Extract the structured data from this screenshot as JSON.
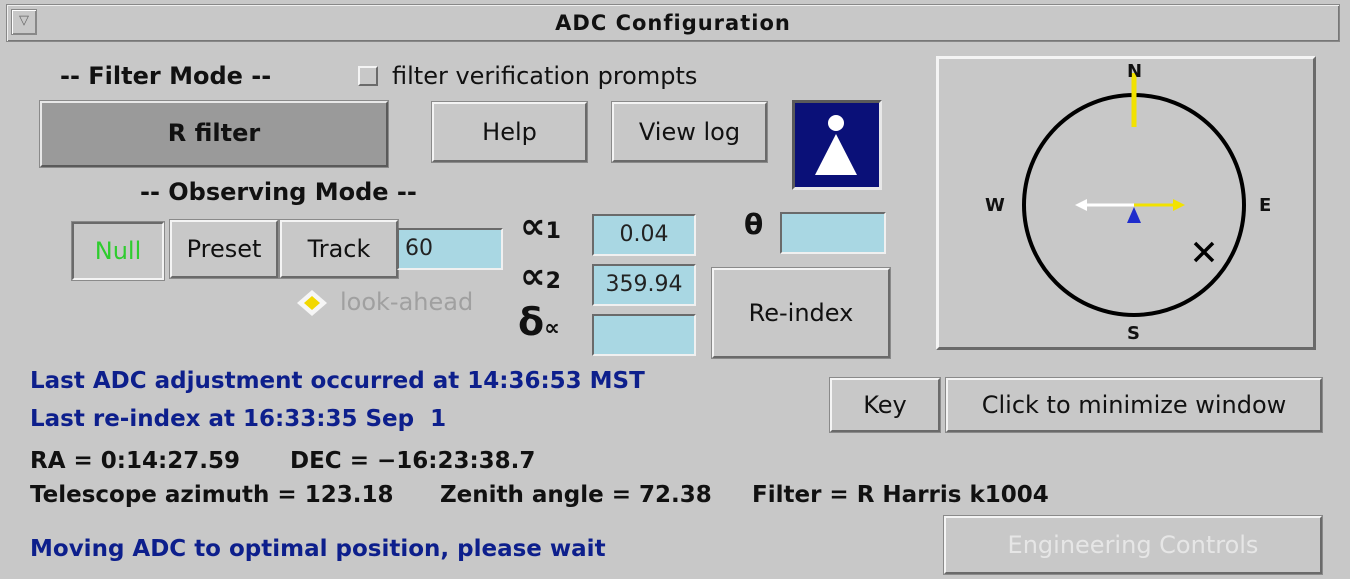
{
  "window": {
    "title": "ADC Configuration",
    "menu_glyph": "▽"
  },
  "filter_mode": {
    "heading": "-- Filter Mode --",
    "verification_label": "filter verification prompts",
    "filter_button": "R filter"
  },
  "toolbar": {
    "help": "Help",
    "view_log": "View log"
  },
  "observing_mode": {
    "heading": "-- Observing Mode --",
    "null_label": "Null",
    "preset_label": "Preset",
    "track_label": "Track",
    "track_value": "60",
    "lookahead_label": "look-ahead"
  },
  "angles": {
    "alpha1_symbol": "∝",
    "alpha1_sub": "1",
    "alpha1_value": "0.04",
    "alpha2_symbol": "∝",
    "alpha2_sub": "2",
    "alpha2_value": "359.94",
    "delta_symbol": "δ",
    "delta_sub": "∝",
    "delta_value": "",
    "theta_symbol": "θ",
    "theta_value": "",
    "reindex_button": "Re-index"
  },
  "compass": {
    "n": "N",
    "s": "S",
    "e": "E",
    "w": "W"
  },
  "buttons": {
    "key": "Key",
    "minimize": "Click to minimize window",
    "engineering": "Engineering Controls"
  },
  "status": {
    "last_adjustment": "Last ADC adjustment occurred at 14:36:53 MST",
    "last_reindex": "Last re-index at 16:33:35 Sep  1",
    "ra": "RA = 0:14:27.59",
    "dec": "DEC = −16:23:38.7",
    "azimuth": "Telescope azimuth = 123.18",
    "zenith": "Zenith angle = 72.38",
    "filter": "Filter = R Harris k1004",
    "message": "Moving ADC to optimal position, please wait"
  },
  "colors": {
    "background": "#c8c8c8",
    "field": "#a9d7e3",
    "status_blue": "#0d1f8c",
    "null_green": "#2ecc2e",
    "compass_yellow": "#f2e200",
    "compass_blue": "#1e2ccc",
    "logo_navy": "#0a1078"
  }
}
